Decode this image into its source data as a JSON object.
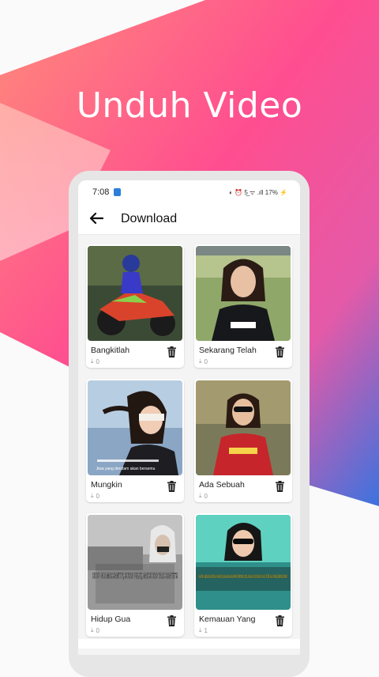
{
  "headline": "Unduh Video",
  "status_bar": {
    "time": "7:08",
    "icons_text": "◐ ⏰ 5̲ ᯤ .ıll 17% ⚡"
  },
  "app_bar": {
    "back_icon": "arrow-left-icon",
    "title": "Download"
  },
  "videos": [
    {
      "title": "Bangkitlah",
      "count": "0"
    },
    {
      "title": "Sekarang Telah",
      "count": "0"
    },
    {
      "title": "Mungkin",
      "count": "0"
    },
    {
      "title": "Ada Sebuah",
      "count": "0"
    },
    {
      "title": "Hidup Gua",
      "count": "0"
    },
    {
      "title": "Kemauan Yang",
      "count": "1"
    }
  ],
  "thumb_texts": {
    "v4_caption": "Jiwa yang dendam akan bersemu",
    "v6_overlay": "KARNA PADA DASARNYA SUKSES, BUKANLAH DARI KETURUNAN MELAINKAN, KEMAUAN YANG TERTANAM PADA DIRI SENDIRI.",
    "v5_overlay": "HIDUP GUA MAH SANTUY, SUKA? PELET, GAK SUKA? YAAH SANTET!!"
  },
  "colors": {
    "gradient_pink": "#ff3d8b",
    "gradient_blue": "#3f79e0",
    "gradient_orange": "#ff7a6e"
  }
}
